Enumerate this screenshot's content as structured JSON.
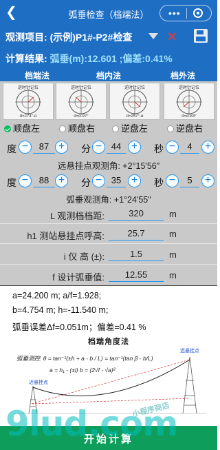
{
  "window": {
    "title": "弧垂检查（档端法）"
  },
  "header": {
    "project_label": "观测项目:",
    "project_value": "(示例)P1#-P2#检查",
    "result_label": "计算结果:",
    "result_value": "弧垂(m):12.601 ;偏差:0.41%"
  },
  "tabs": [
    {
      "label": "档端法",
      "active": true
    },
    {
      "label": "档内法",
      "active": false
    },
    {
      "label": "档外法",
      "active": false
    }
  ],
  "diagrams": [
    {
      "top": "逆时针记位",
      "bottom": "d=273°-α"
    },
    {
      "top": "逆时针记位",
      "bottom": "d=α-97°"
    },
    {
      "top": "逆时针记位",
      "bottom": "d=257°-α"
    },
    {
      "top": "逆时针记位",
      "bottom": "d=α-83°"
    }
  ],
  "modes": [
    {
      "label": "顺盘左",
      "selected": true
    },
    {
      "label": "顺盘右",
      "selected": false
    },
    {
      "label": "逆盘左",
      "selected": false
    },
    {
      "label": "逆盘右",
      "selected": false
    }
  ],
  "units": {
    "deg": "度",
    "min": "分",
    "sec": "秒"
  },
  "buttons": {
    "minus": "−",
    "plus": "+"
  },
  "angle1": {
    "deg": "87",
    "min": "44",
    "sec": "4"
  },
  "angle1_result": "远悬挂点观测角: +2°15'56\"",
  "angle2": {
    "deg": "88",
    "min": "35",
    "sec": "5"
  },
  "angle2_result": "弧垂观测角: +1°24'55\"",
  "fields": [
    {
      "label": "L 观测档档距:",
      "value": "320",
      "unit": "m"
    },
    {
      "label": "h1 测站悬挂点呼高:",
      "value": "25.7",
      "unit": "m"
    },
    {
      "label": "i 仪 高 (±):",
      "value": "1.5",
      "unit": "m"
    },
    {
      "label": "f 设计弧垂值:",
      "value": "12.55",
      "unit": "m"
    }
  ],
  "results": [
    "a=24.200 m;    a/f=1.928;",
    "b=4.754 m;    h=-11.540 m;",
    "弧垂误差Δf=0.051m；偏差=0.41 %"
  ],
  "figure": {
    "title": "档端角度法",
    "formula1": "弧垂测控: θ = tan⁻¹(±h + a - b / L) = tan⁻¹(tan β - b/L)",
    "formula2": "a = h₁ - (±i)        b = (2√f - √a)²",
    "tag_far": "远悬挂点",
    "tag_near": "近悬挂点"
  },
  "action": {
    "calc_label": "开始计算"
  },
  "watermark": {
    "text": "9lud.com",
    "sub": "小程序商店"
  },
  "colors": {
    "primary": "#1e6fc4",
    "accent": "#2196f3",
    "action": "#0e9d5a",
    "result": "#9fe1ff"
  }
}
